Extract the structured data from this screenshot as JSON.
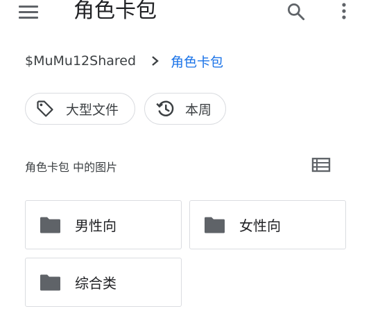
{
  "app_bar": {
    "title": "角色卡包",
    "icons": [
      "menu-icon",
      "search-icon",
      "more-vert-icon"
    ]
  },
  "breadcrumb": {
    "root": "$MuMu12Shared",
    "current": "角色卡包"
  },
  "filters": [
    {
      "label": "大型文件",
      "icon": "tag-icon"
    },
    {
      "label": "本周",
      "icon": "history-icon"
    }
  ],
  "section": {
    "title": "角色卡包 中的图片",
    "view_toggle_icon": "list-view-icon"
  },
  "folders": [
    {
      "name": "男性向",
      "icon": "folder-icon"
    },
    {
      "name": "女性向",
      "icon": "folder-icon"
    },
    {
      "name": "综合类",
      "icon": "folder-icon"
    }
  ],
  "colors": {
    "accent": "#1a73e8",
    "icon": "#5f6368",
    "border": "#dadce0",
    "text": "#202124"
  }
}
